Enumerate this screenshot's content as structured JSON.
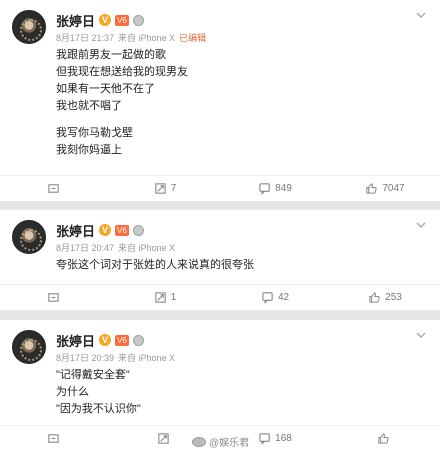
{
  "posts": [
    {
      "author": "张婷日",
      "v_badge": "V",
      "vip_badge": "V6",
      "meta": {
        "time": "8月17日 21:37",
        "source": "来自 iPhone X",
        "edited": "已编辑"
      },
      "lines": [
        "我跟前男友一起做的歌",
        "但我现在想送给我的现男友",
        "如果有一天他不在了",
        "我也就不唱了",
        "",
        "我写你马勒戈壁",
        "我刻你妈逼上"
      ],
      "actions": {
        "forward": "",
        "repost": "7",
        "comment": "849",
        "like": "7047"
      }
    },
    {
      "author": "张婷日",
      "v_badge": "V",
      "vip_badge": "V6",
      "meta": {
        "time": "8月17日 20:47",
        "source": "来自 iPhone X",
        "edited": ""
      },
      "lines": [
        "夸张这个词对于张姓的人来说真的很夸张"
      ],
      "actions": {
        "forward": "",
        "repost": "1",
        "comment": "42",
        "like": "253"
      }
    },
    {
      "author": "张婷日",
      "v_badge": "V",
      "vip_badge": "V6",
      "meta": {
        "time": "8月17日 20:39",
        "source": "来自 iPhone X",
        "edited": ""
      },
      "lines": [
        "\"记得戴安全套\"",
        "为什么",
        "\"因为我不认识你\""
      ],
      "actions": {
        "forward": "",
        "repost": "",
        "comment": "168",
        "like": ""
      }
    }
  ],
  "watermark": "@娱乐君"
}
